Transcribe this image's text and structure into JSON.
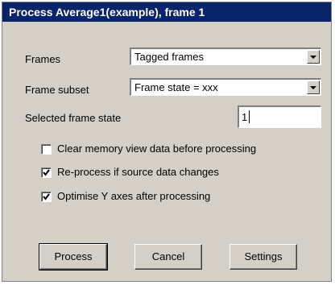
{
  "window": {
    "title": "Process Average1(example), frame 1"
  },
  "form": {
    "frames": {
      "label": "Frames",
      "value": "Tagged frames"
    },
    "frame_subset": {
      "label": "Frame subset",
      "value": "Frame state = xxx"
    },
    "selected_state": {
      "label": "Selected frame state",
      "value": "1"
    }
  },
  "options": [
    {
      "label": "Clear memory view data before processing",
      "checked": false
    },
    {
      "label": "Re-process if source data changes",
      "checked": true
    },
    {
      "label": "Optimise Y axes after processing",
      "checked": true
    }
  ],
  "buttons": {
    "process": "Process",
    "cancel": "Cancel",
    "settings": "Settings"
  }
}
